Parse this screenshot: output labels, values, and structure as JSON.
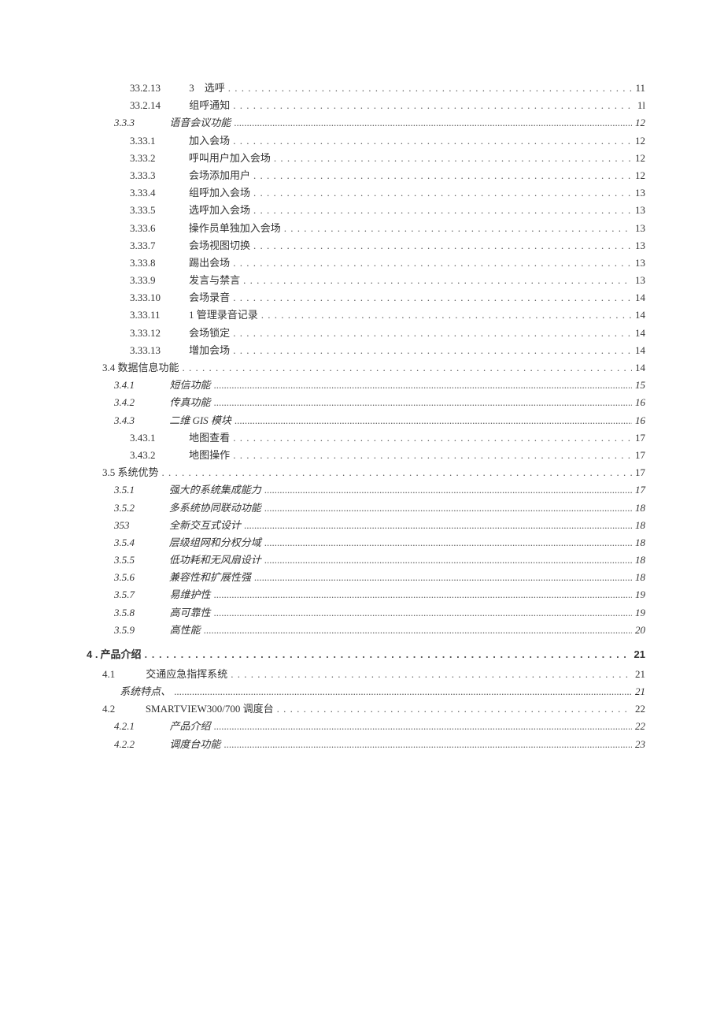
{
  "toc": [
    {
      "indent": 3,
      "numClass": "num-w-lg",
      "num": "33.2.13",
      "title": "3　选呼",
      "page": "11",
      "italic": false,
      "leader": "dot"
    },
    {
      "indent": 3,
      "numClass": "num-w-lg",
      "num": "33.2.14",
      "title": "组呼通知",
      "page": "1l",
      "italic": false,
      "leader": "dot"
    },
    {
      "indent": 2,
      "numClass": "num-w-md",
      "num": "3.3.3",
      "title": "语音会议功能",
      "page": "12",
      "italic": true,
      "leader": "dash"
    },
    {
      "indent": 3,
      "numClass": "num-w-lg",
      "num": "3.33.1",
      "title": "加入会场",
      "page": "12",
      "italic": false,
      "leader": "dot"
    },
    {
      "indent": 3,
      "numClass": "num-w-lg",
      "num": "3.33.2",
      "title": "呼叫用户加入会场",
      "page": "12",
      "italic": false,
      "leader": "dot"
    },
    {
      "indent": 3,
      "numClass": "num-w-lg",
      "num": "3.33.3",
      "title": "会场添加用户",
      "page": "12",
      "italic": false,
      "leader": "dot"
    },
    {
      "indent": 3,
      "numClass": "num-w-lg",
      "num": "3.33.4",
      "title": "组呼加入会场",
      "page": "13",
      "italic": false,
      "leader": "dot"
    },
    {
      "indent": 3,
      "numClass": "num-w-lg",
      "num": "3.33.5",
      "title": "选呼加入会场",
      "page": "13",
      "italic": false,
      "leader": "dot"
    },
    {
      "indent": 3,
      "numClass": "num-w-lg",
      "num": "3.33.6",
      "title": "操作员单独加入会场",
      "page": "13",
      "italic": false,
      "leader": "dot"
    },
    {
      "indent": 3,
      "numClass": "num-w-lg",
      "num": "3.33.7",
      "title": "会场视图切换",
      "page": "13",
      "italic": false,
      "leader": "dot"
    },
    {
      "indent": 3,
      "numClass": "num-w-lg",
      "num": "3.33.8",
      "title": "踢出会场",
      "page": "13",
      "italic": false,
      "leader": "dot"
    },
    {
      "indent": 3,
      "numClass": "num-w-lg",
      "num": "3.33.9",
      "title": "发言与禁言",
      "page": "13",
      "italic": false,
      "leader": "dot"
    },
    {
      "indent": 3,
      "numClass": "num-w-lg",
      "num": "3.33.10",
      "title": "会场录音",
      "page": "14",
      "italic": false,
      "leader": "dot"
    },
    {
      "indent": 3,
      "numClass": "num-w-lg",
      "num": "3.33.11",
      "title": "1 管理录音记录",
      "page": "14",
      "italic": false,
      "leader": "dot"
    },
    {
      "indent": 3,
      "numClass": "num-w-lg",
      "num": "3.33.12",
      "title": "会场锁定",
      "page": "14",
      "italic": false,
      "leader": "dot"
    },
    {
      "indent": 3,
      "numClass": "num-w-lg",
      "num": "3.33.13",
      "title": "增加会场",
      "page": "14",
      "italic": false,
      "leader": "dot"
    },
    {
      "indent": 1,
      "numClass": "",
      "num": "3.4 数据信息功能",
      "title": "",
      "page": "14",
      "italic": false,
      "leader": "dot"
    },
    {
      "indent": 2,
      "numClass": "num-w-md",
      "num": "3.4.1",
      "title": "短信功能",
      "page": "15",
      "italic": true,
      "leader": "dash"
    },
    {
      "indent": 2,
      "numClass": "num-w-md",
      "num": "3.4.2",
      "title": "传真功能",
      "page": "16",
      "italic": true,
      "leader": "dash"
    },
    {
      "indent": 2,
      "numClass": "num-w-md",
      "num": "3.4.3",
      "title": "二维 GIS 模块",
      "page": "16",
      "italic": true,
      "leader": "dash"
    },
    {
      "indent": 3,
      "numClass": "num-w-lg",
      "num": "3.43.1",
      "title": "地图查看",
      "page": "17",
      "italic": false,
      "leader": "dot"
    },
    {
      "indent": 3,
      "numClass": "num-w-lg",
      "num": "3.43.2",
      "title": "地图操作",
      "page": "17",
      "italic": false,
      "leader": "dot"
    },
    {
      "indent": 1,
      "numClass": "",
      "num": "3.5 系统优势",
      "title": "",
      "page": "17",
      "italic": false,
      "leader": "dot"
    },
    {
      "indent": 2,
      "numClass": "num-w-md",
      "num": "3.5.1",
      "title": "强大的系统集成能力",
      "page": "17",
      "italic": true,
      "leader": "dash"
    },
    {
      "indent": 2,
      "numClass": "num-w-md",
      "num": "3.5.2",
      "title": "多系统协同联动功能",
      "page": "18",
      "italic": true,
      "leader": "dash"
    },
    {
      "indent": 2,
      "numClass": "num-w-md",
      "num": "353",
      "title": "全新交互式设计",
      "page": "18",
      "italic": true,
      "leader": "dash"
    },
    {
      "indent": 2,
      "numClass": "num-w-md",
      "num": "3.5.4",
      "title": "层级组网和分权分域",
      "page": "18",
      "italic": true,
      "leader": "dash"
    },
    {
      "indent": 2,
      "numClass": "num-w-md",
      "num": "3.5.5",
      "title": "低功耗和无风扇设计",
      "page": "18",
      "italic": true,
      "leader": "dash"
    },
    {
      "indent": 2,
      "numClass": "num-w-md",
      "num": "3.5.6",
      "title": "兼容性和扩展性强",
      "page": "18",
      "italic": true,
      "leader": "dash"
    },
    {
      "indent": 2,
      "numClass": "num-w-md",
      "num": "3.5.7",
      "title": "易维护性",
      "page": "19",
      "italic": true,
      "leader": "dash"
    },
    {
      "indent": 2,
      "numClass": "num-w-md",
      "num": "3.5.8",
      "title": "高可靠性",
      "page": "19",
      "italic": true,
      "leader": "dash"
    },
    {
      "indent": 2,
      "numClass": "num-w-md",
      "num": "3.5.9",
      "title": "高性能",
      "page": "20",
      "italic": true,
      "leader": "dash"
    }
  ],
  "chapter": {
    "num": "4 .",
    "title": "产品介绍",
    "page": "21"
  },
  "toc2": [
    {
      "indent": 1,
      "numClass": "num-w-sm",
      "num": "4.1",
      "title": "交通应急指挥系统",
      "page": "21",
      "italic": false,
      "leader": "dot"
    },
    {
      "indent": 2,
      "numClass": "",
      "num": "",
      "title": "系统特点、",
      "page": "21",
      "italic": true,
      "leader": "dash"
    },
    {
      "indent": 1,
      "numClass": "num-w-sm",
      "num": "4.2",
      "title": "SMARTVIEW300/700 调度台",
      "page": "22",
      "italic": false,
      "leader": "dot"
    },
    {
      "indent": 2,
      "numClass": "num-w-md",
      "num": "4.2.1",
      "title": "产品介绍",
      "page": "22",
      "italic": true,
      "leader": "dash"
    },
    {
      "indent": 2,
      "numClass": "num-w-md",
      "num": "4.2.2",
      "title": "调度台功能",
      "page": "23",
      "italic": true,
      "leader": "dash"
    }
  ]
}
